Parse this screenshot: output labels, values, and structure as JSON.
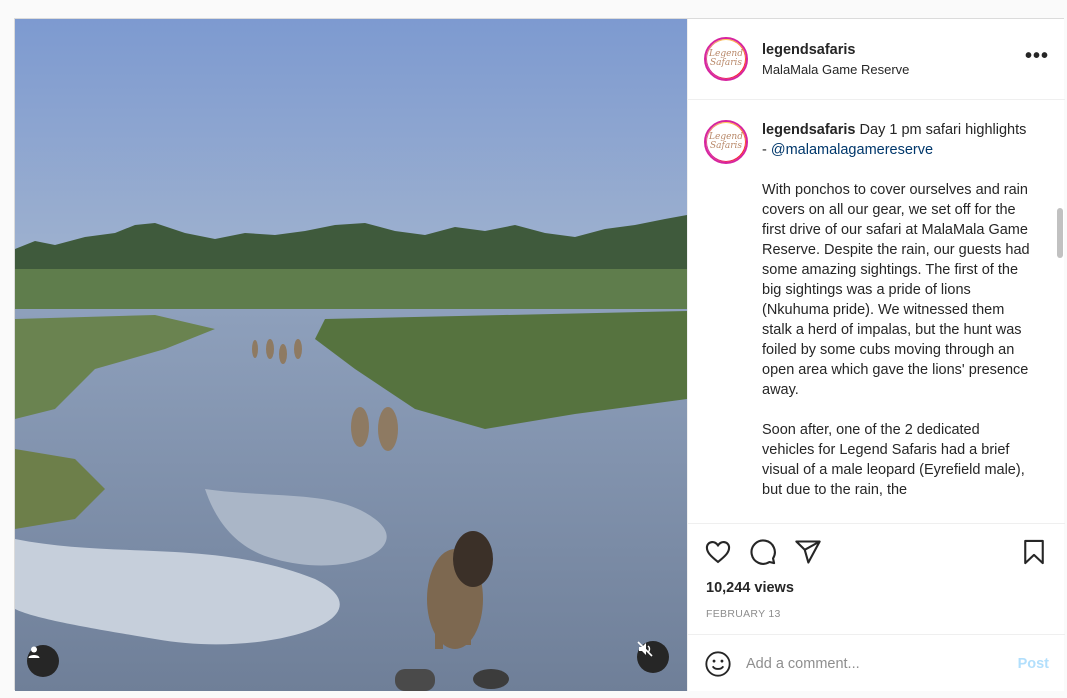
{
  "post": {
    "username": "legendsafaris",
    "location": "MalaMala Game Reserve",
    "avatar_text": "Legend Safaris",
    "more_label": "•••"
  },
  "caption": {
    "username": "legendsafaris",
    "intro": "Day 1 pm safari highlights - ",
    "mention": "@malamalagamereserve",
    "paragraph1": "With ponchos to cover ourselves and rain covers on all our gear, we set off for the first drive of our safari at MalaMala Game Reserve. Despite the rain, our guests had some amazing sightings. The first of the big sightings was a pride of lions (Nkuhuma pride). We witnessed them stalk a herd of impalas, but the hunt was foiled by some cubs moving through an open area which gave the lions' presence away.",
    "paragraph2": "Soon after, one of the 2 dedicated vehicles for Legend Safaris had a brief visual of a male leopard (Eyrefield male), but due to the rain, the"
  },
  "stats": {
    "views": "10,244 views",
    "date": "FEBRUARY 13"
  },
  "comment_box": {
    "placeholder": "Add a comment...",
    "post_label": "Post"
  },
  "icons": {
    "like": "heart-icon",
    "comment": "comment-bubble-icon",
    "share": "paper-plane-icon",
    "save": "bookmark-icon",
    "emoji": "smiley-icon",
    "mute": "muted-speaker-icon",
    "tag": "user-tag-icon"
  },
  "colors": {
    "story_ring": "#d6249f",
    "link": "#00376b",
    "post_button_disabled": "#b2dffc",
    "secondary_text": "#8e8e8e"
  }
}
